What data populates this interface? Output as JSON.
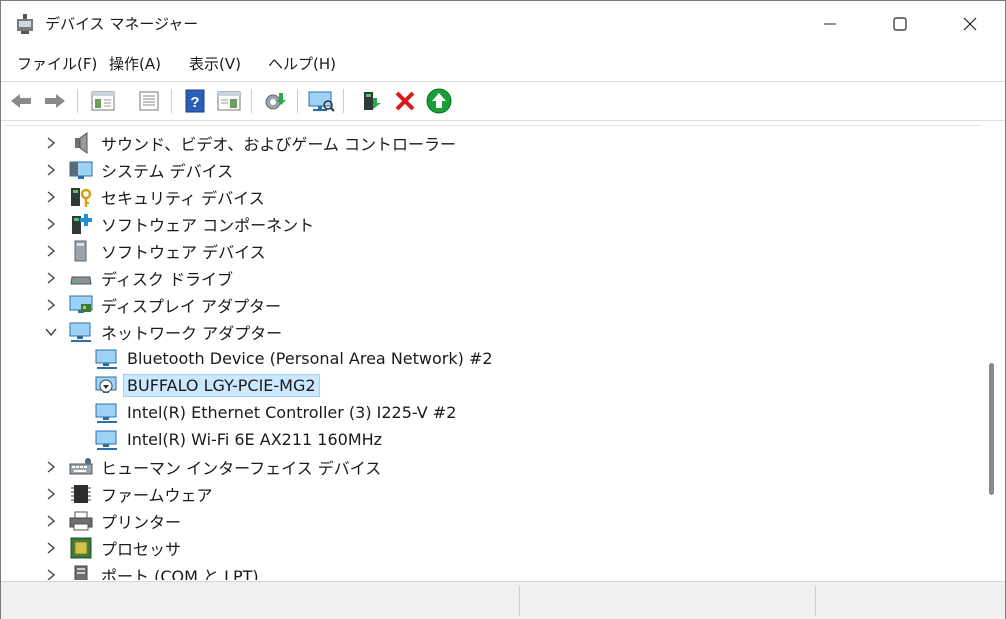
{
  "window": {
    "title": "デバイス マネージャー"
  },
  "menu": [
    "ファイル(F)",
    "操作(A)",
    "表示(V)",
    "ヘルプ(H)"
  ],
  "toolbar": {
    "buttons": [
      "back-icon",
      "forward-icon",
      "show-hide-tree-icon",
      "properties-icon",
      "help-icon",
      "view-icon",
      "update-driver-icon",
      "scan-hardware-icon",
      "enable-device-icon",
      "uninstall-icon",
      "update-icon"
    ]
  },
  "tree": {
    "items": [
      {
        "label": "サウンド、ビデオ、およびゲーム コントローラー",
        "icon": "speaker-icon",
        "expanded": false
      },
      {
        "label": "システム デバイス",
        "icon": "system-device-icon",
        "expanded": false
      },
      {
        "label": "セキュリティ デバイス",
        "icon": "security-key-icon",
        "expanded": false
      },
      {
        "label": "ソフトウェア コンポーネント",
        "icon": "software-component-icon",
        "expanded": false
      },
      {
        "label": "ソフトウェア デバイス",
        "icon": "software-device-icon",
        "expanded": false
      },
      {
        "label": "ディスク ドライブ",
        "icon": "disk-drive-icon",
        "expanded": false
      },
      {
        "label": "ディスプレイ アダプター",
        "icon": "display-adapter-icon",
        "expanded": false
      },
      {
        "label": "ネットワーク アダプター",
        "icon": "network-adapter-icon",
        "expanded": true,
        "children": [
          {
            "label": "Bluetooth Device (Personal Area Network) #2",
            "icon": "network-adapter-icon"
          },
          {
            "label": "BUFFALO LGY-PCIE-MG2",
            "icon": "network-adapter-disabled-icon",
            "selected": true
          },
          {
            "label": "Intel(R) Ethernet Controller (3) I225-V #2",
            "icon": "network-adapter-icon"
          },
          {
            "label": "Intel(R) Wi-Fi 6E AX211 160MHz",
            "icon": "network-adapter-icon"
          }
        ]
      },
      {
        "label": "ヒューマン インターフェイス デバイス",
        "icon": "hid-icon",
        "expanded": false
      },
      {
        "label": "ファームウェア",
        "icon": "firmware-icon",
        "expanded": false
      },
      {
        "label": "プリンター",
        "icon": "printer-icon",
        "expanded": false
      },
      {
        "label": "プロセッサ",
        "icon": "processor-icon",
        "expanded": false
      },
      {
        "label": "ポート (COM と LPT)",
        "icon": "port-icon",
        "expanded": false
      }
    ]
  },
  "colors": {
    "selection_bg": "#cce8ff",
    "selection_border": "#99d1ff",
    "accent_blue": "#1e90d8",
    "close_red": "#e81123",
    "update_green": "#1a9e3a"
  }
}
